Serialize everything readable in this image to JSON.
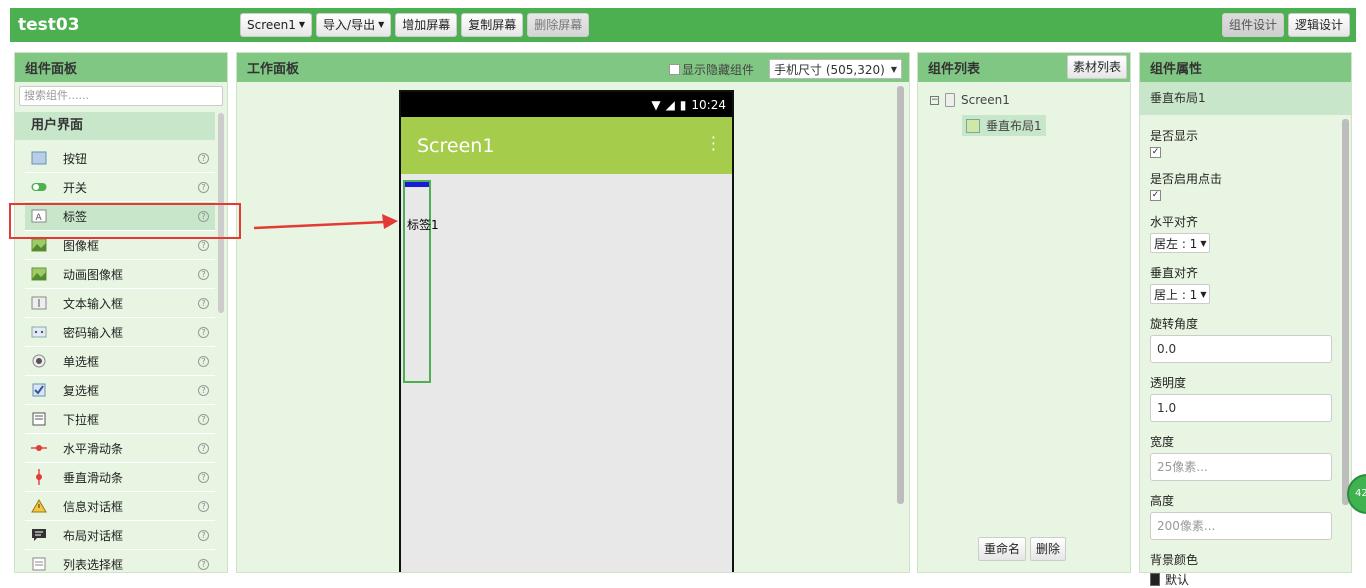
{
  "app": {
    "title": "test03"
  },
  "toolbar": {
    "screen_select": "Screen1",
    "import_export": "导入/导出",
    "add_screen": "增加屏幕",
    "copy_screen": "复制屏幕",
    "delete_screen": "删除屏幕",
    "designer": "组件设计",
    "blocks": "逻辑设计"
  },
  "palette": {
    "title": "组件面板",
    "search_placeholder": "搜索组件......",
    "category": "用户界面",
    "help": "?",
    "items": [
      {
        "label": "按钮",
        "icon": "button-icon"
      },
      {
        "label": "开关",
        "icon": "switch-icon"
      },
      {
        "label": "标签",
        "icon": "label-icon"
      },
      {
        "label": "图像框",
        "icon": "image-icon"
      },
      {
        "label": "动画图像框",
        "icon": "animated-image-icon"
      },
      {
        "label": "文本输入框",
        "icon": "textbox-icon"
      },
      {
        "label": "密码输入框",
        "icon": "password-icon"
      },
      {
        "label": "单选框",
        "icon": "radio-icon"
      },
      {
        "label": "复选框",
        "icon": "checkbox-icon"
      },
      {
        "label": "下拉框",
        "icon": "spinner-icon"
      },
      {
        "label": "水平滑动条",
        "icon": "hslider-icon"
      },
      {
        "label": "垂直滑动条",
        "icon": "vslider-icon"
      },
      {
        "label": "信息对话框",
        "icon": "alert-icon"
      },
      {
        "label": "布局对话框",
        "icon": "dialog-icon"
      },
      {
        "label": "列表选择框",
        "icon": "listpicker-icon"
      }
    ]
  },
  "viewer": {
    "title": "工作面板",
    "show_hidden": "显示隐藏组件",
    "size": "手机尺寸 (505,320)",
    "status_time": "10:24",
    "screen_title": "Screen1",
    "label_text": "标签1"
  },
  "tree": {
    "title": "组件列表",
    "media": "素材列表",
    "collapse": "−",
    "root": "Screen1",
    "child": "垂直布局1",
    "rename": "重命名",
    "delete": "删除"
  },
  "props": {
    "title": "组件属性",
    "selected": "垂直布局1",
    "visible_label": "是否显示",
    "enabled_label": "是否启用点击",
    "halign_label": "水平对齐",
    "halign_value": "居左 : 1",
    "valign_label": "垂直对齐",
    "valign_value": "居上 : 1",
    "rotation_label": "旋转角度",
    "rotation_value": "0.0",
    "opacity_label": "透明度",
    "opacity_value": "1.0",
    "width_label": "宽度",
    "width_value": "25像素...",
    "height_label": "高度",
    "height_value": "200像素...",
    "bgcolor_label": "背景颜色",
    "bgcolor_value": "默认",
    "check": "✓"
  },
  "colors": {
    "brand": "#4caf50",
    "appbar": "#a5cc4a",
    "highlight": "#e53935"
  },
  "badge": "42"
}
